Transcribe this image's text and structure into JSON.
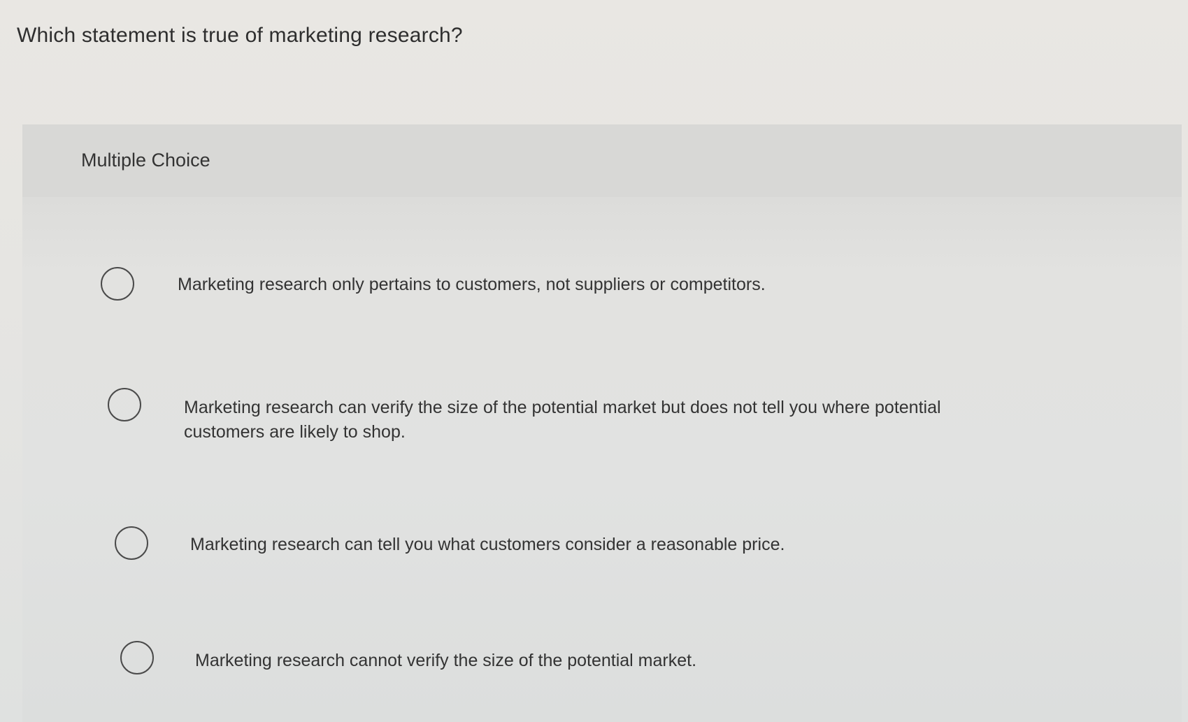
{
  "question": {
    "text": "Which statement is true of marketing research?"
  },
  "choice_block": {
    "label": "Multiple Choice",
    "options": [
      {
        "text": "Marketing research only pertains to customers, not suppliers or competitors."
      },
      {
        "text": "Marketing research can verify the size of the potential market but does not tell you where potential customers are likely to shop."
      },
      {
        "text": "Marketing research can tell you what customers consider a reasonable price."
      },
      {
        "text": "Marketing research cannot verify the size of the potential market."
      }
    ]
  }
}
